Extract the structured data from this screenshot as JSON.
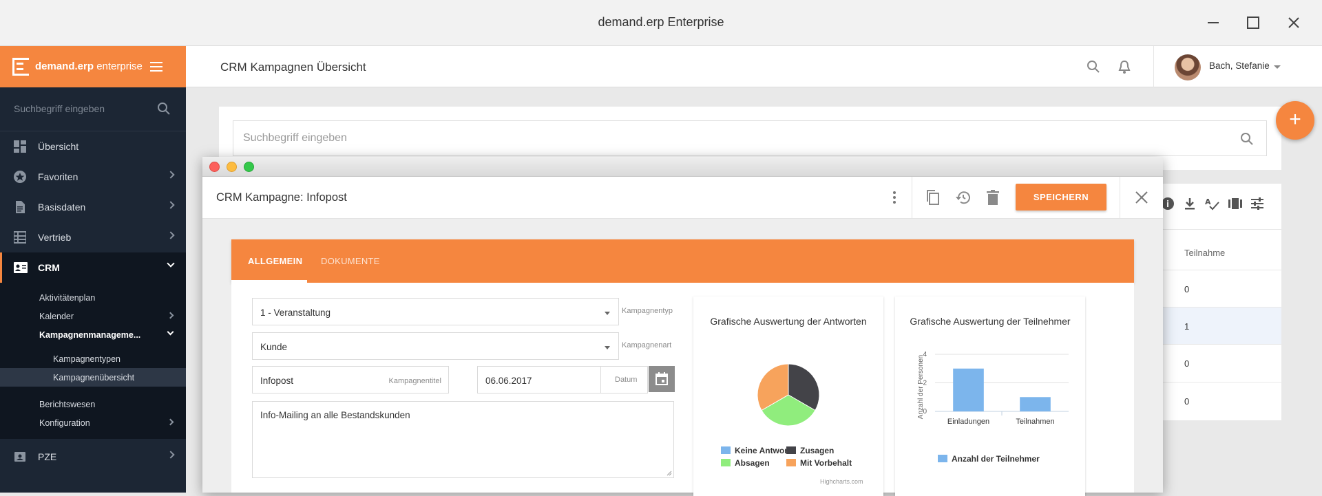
{
  "window": {
    "title": "demand.erp Enterprise"
  },
  "sidebar": {
    "logo": {
      "brand": "demand.erp",
      "suffix": " enterprise"
    },
    "search_placeholder": "Suchbegriff eingeben",
    "items": [
      {
        "label": "Übersicht"
      },
      {
        "label": "Favoriten"
      },
      {
        "label": "Basisdaten"
      },
      {
        "label": "Vertrieb"
      },
      {
        "label": "CRM"
      },
      {
        "label": "PZE"
      }
    ],
    "crm_sub": [
      {
        "label": "Aktivitätenplan"
      },
      {
        "label": "Kalender"
      },
      {
        "label": "Kampagnenmanageme..."
      },
      {
        "label": "Kampagnentypen"
      },
      {
        "label": "Kampagnenübersicht"
      },
      {
        "label": "Berichtswesen"
      },
      {
        "label": "Konfiguration"
      }
    ]
  },
  "header": {
    "page_title": "CRM Kampagnen Übersicht",
    "user_name": "Bach, Stefanie"
  },
  "list": {
    "search_placeholder": "Suchbegriff eingeben",
    "column_header": "Teilnahme",
    "rows": [
      "0",
      "1",
      "0",
      "0"
    ]
  },
  "dialog": {
    "title": "CRM Kampagne: Infopost",
    "save_label": "SPEICHERN",
    "tabs": [
      {
        "label": "ALLGEMEIN",
        "active": true
      },
      {
        "label": "DOKUMENTE",
        "active": false
      }
    ],
    "form": {
      "kampagnentyp": {
        "value": "1 - Veranstaltung",
        "label": "Kampagnentyp"
      },
      "kampagnenart": {
        "value": "Kunde",
        "label": "Kampagnenart"
      },
      "kampagnentitel": {
        "value": "Infopost",
        "label": "Kampagnentitel"
      },
      "datum": {
        "value": "06.06.2017",
        "label": "Datum"
      },
      "beschreibung": {
        "value": "Info-Mailing an alle Bestandskunden"
      }
    }
  },
  "colors": {
    "accent": "#f5863f",
    "sidebar_bg": "#1c2634"
  },
  "chart_data": [
    {
      "type": "pie",
      "title": "Grafische Auswertung der Antworten",
      "slices": [
        {
          "name": "Zusagen",
          "value": 1,
          "color": "#434348"
        },
        {
          "name": "Absagen",
          "value": 1,
          "color": "#90ed7d"
        },
        {
          "name": "Mit Vorbehalt",
          "value": 1,
          "color": "#f7a35c"
        },
        {
          "name": "Keine Antwort",
          "value": 0,
          "color": "#7cb5ec"
        }
      ],
      "legend": [
        "Keine Antwort",
        "Zusagen",
        "Absagen",
        "Mit Vorbehalt"
      ],
      "credits": "Highcharts.com"
    },
    {
      "type": "bar",
      "title": "Grafische Auswertung der Teilnehmer",
      "categories": [
        "Einladungen",
        "Teilnahmen"
      ],
      "series": [
        {
          "name": "Anzahl der Teilnehmer",
          "values": [
            3,
            1
          ],
          "color": "#7cb5ec"
        }
      ],
      "ylabel": "Anzahl der Personen",
      "ylim": [
        0,
        4
      ],
      "yticks": [
        "0",
        "2",
        "4"
      ],
      "grid": true,
      "legend": "bottom"
    }
  ]
}
